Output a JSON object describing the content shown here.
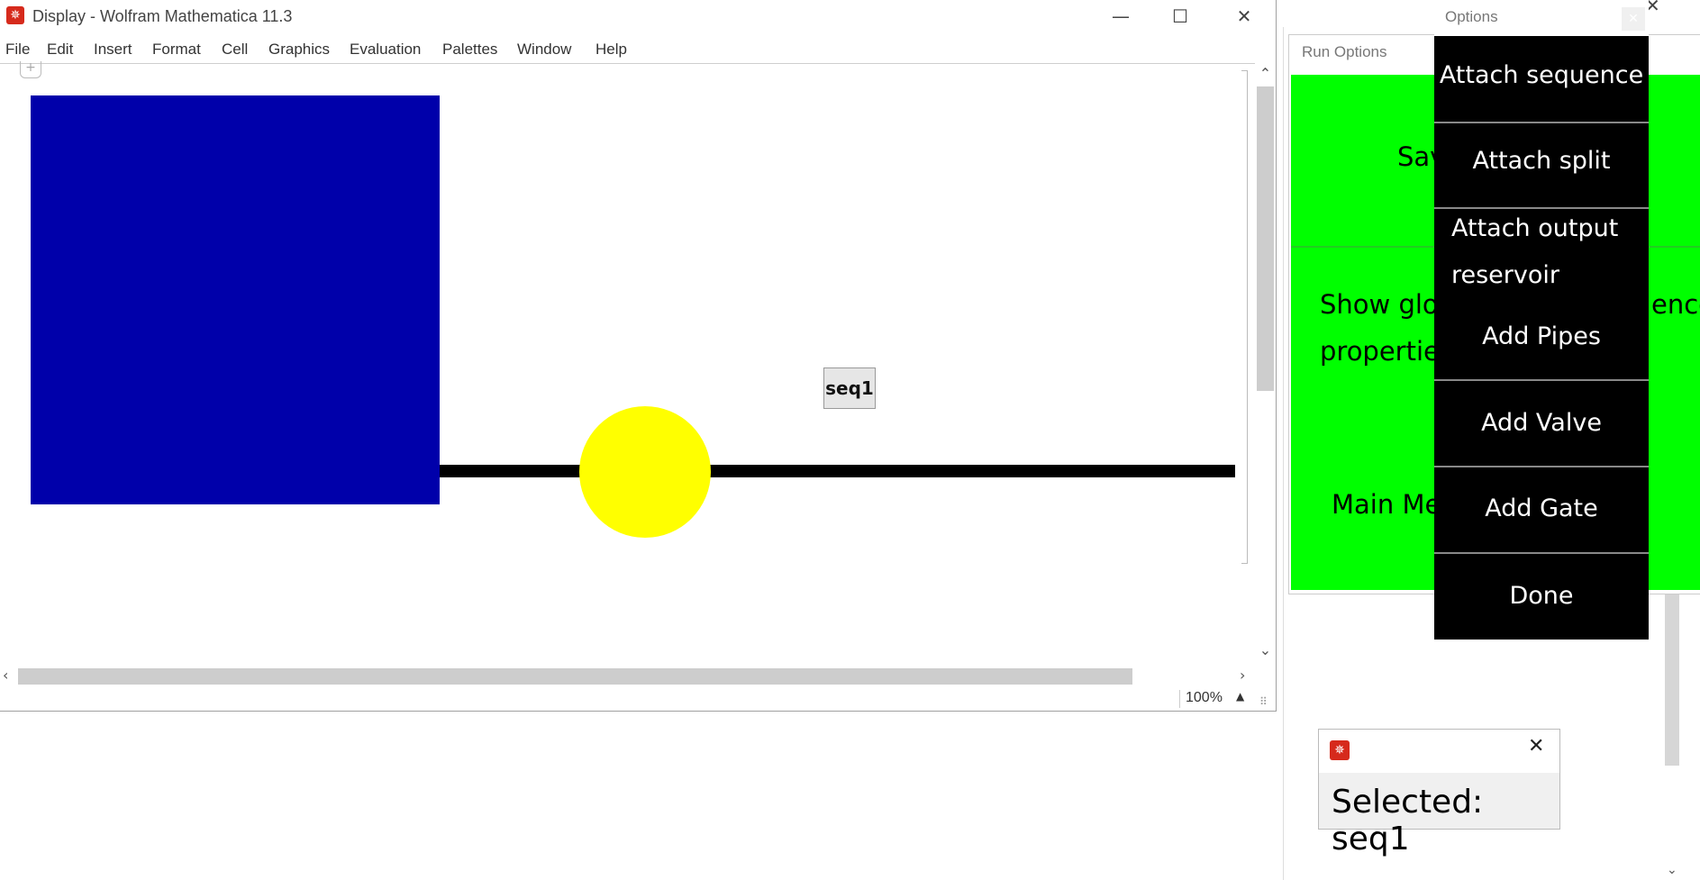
{
  "main_window": {
    "title": "Display - Wolfram Mathematica 11.3",
    "controls": {
      "minimize": "—",
      "maximize": "☐",
      "close": "✕"
    },
    "menu": [
      "File",
      "Edit",
      "Insert",
      "Format",
      "Cell",
      "Graphics",
      "Evaluation",
      "Palettes",
      "Window",
      "Help"
    ],
    "graphic": {
      "reservoir_color": "#0000aa",
      "valve_color": "#ffff00",
      "pipe_color": "#000000",
      "sequence_label": "seq1"
    },
    "zoom": "100%"
  },
  "run_options": {
    "title": "Run Options",
    "items": [
      "Save",
      "Show glob",
      "properties",
      "ence",
      "Main Me"
    ],
    "background": "#00ff00"
  },
  "options": {
    "title": "Options",
    "buttons": [
      "Attach sequence",
      "Attach split",
      "Attach output",
      "reservoir",
      "Add Pipes",
      "Add Valve",
      "Add Gate",
      "Done"
    ]
  },
  "selected_popup": {
    "text": "Selected: seq1"
  }
}
